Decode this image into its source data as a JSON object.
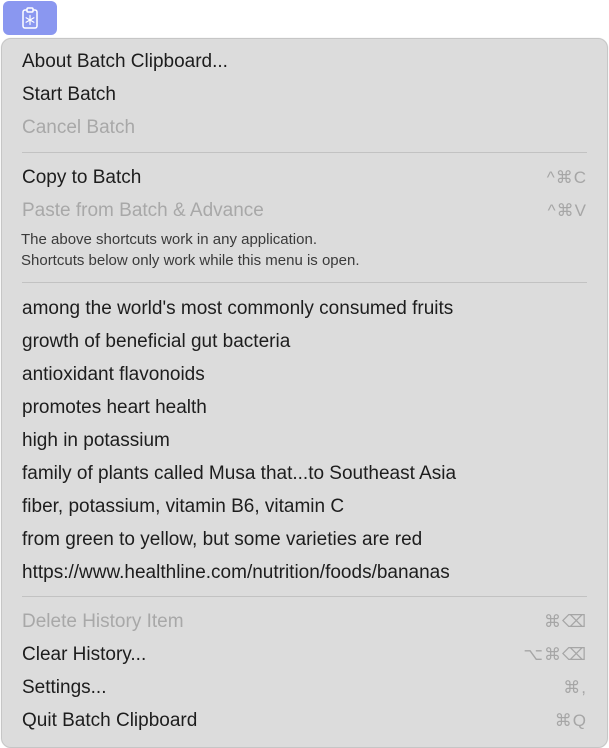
{
  "status_icon": {
    "name": "clipboard-snowflake-icon",
    "color": "#8a97f0"
  },
  "menu": {
    "about": "About Batch Clipboard...",
    "start_batch": "Start Batch",
    "cancel_batch": "Cancel Batch",
    "copy_to_batch": {
      "label": "Copy to Batch",
      "shortcut": "^⌘C"
    },
    "paste_from_batch": {
      "label": "Paste from Batch & Advance",
      "shortcut": "^⌘V"
    },
    "note_line1": "The above shortcuts work in any application.",
    "note_line2": "Shortcuts below only work while this menu is open.",
    "history": [
      "among the world's most commonly consumed fruits",
      "growth of beneficial gut bacteria",
      "antioxidant flavonoids",
      "promotes heart health",
      "high in potassium",
      "family of plants called Musa that...to Southeast Asia",
      "fiber, potassium, vitamin B6, vitamin C",
      "from green to yellow, but some varieties are red",
      "https://www.healthline.com/nutrition/foods/bananas"
    ],
    "delete_history_item": {
      "label": "Delete History Item",
      "shortcut": "⌘⌫"
    },
    "clear_history": {
      "label": "Clear History...",
      "shortcut": "⌥⌘⌫"
    },
    "settings": {
      "label": "Settings...",
      "shortcut": "⌘,"
    },
    "quit": {
      "label": "Quit Batch Clipboard",
      "shortcut": "⌘Q"
    }
  }
}
